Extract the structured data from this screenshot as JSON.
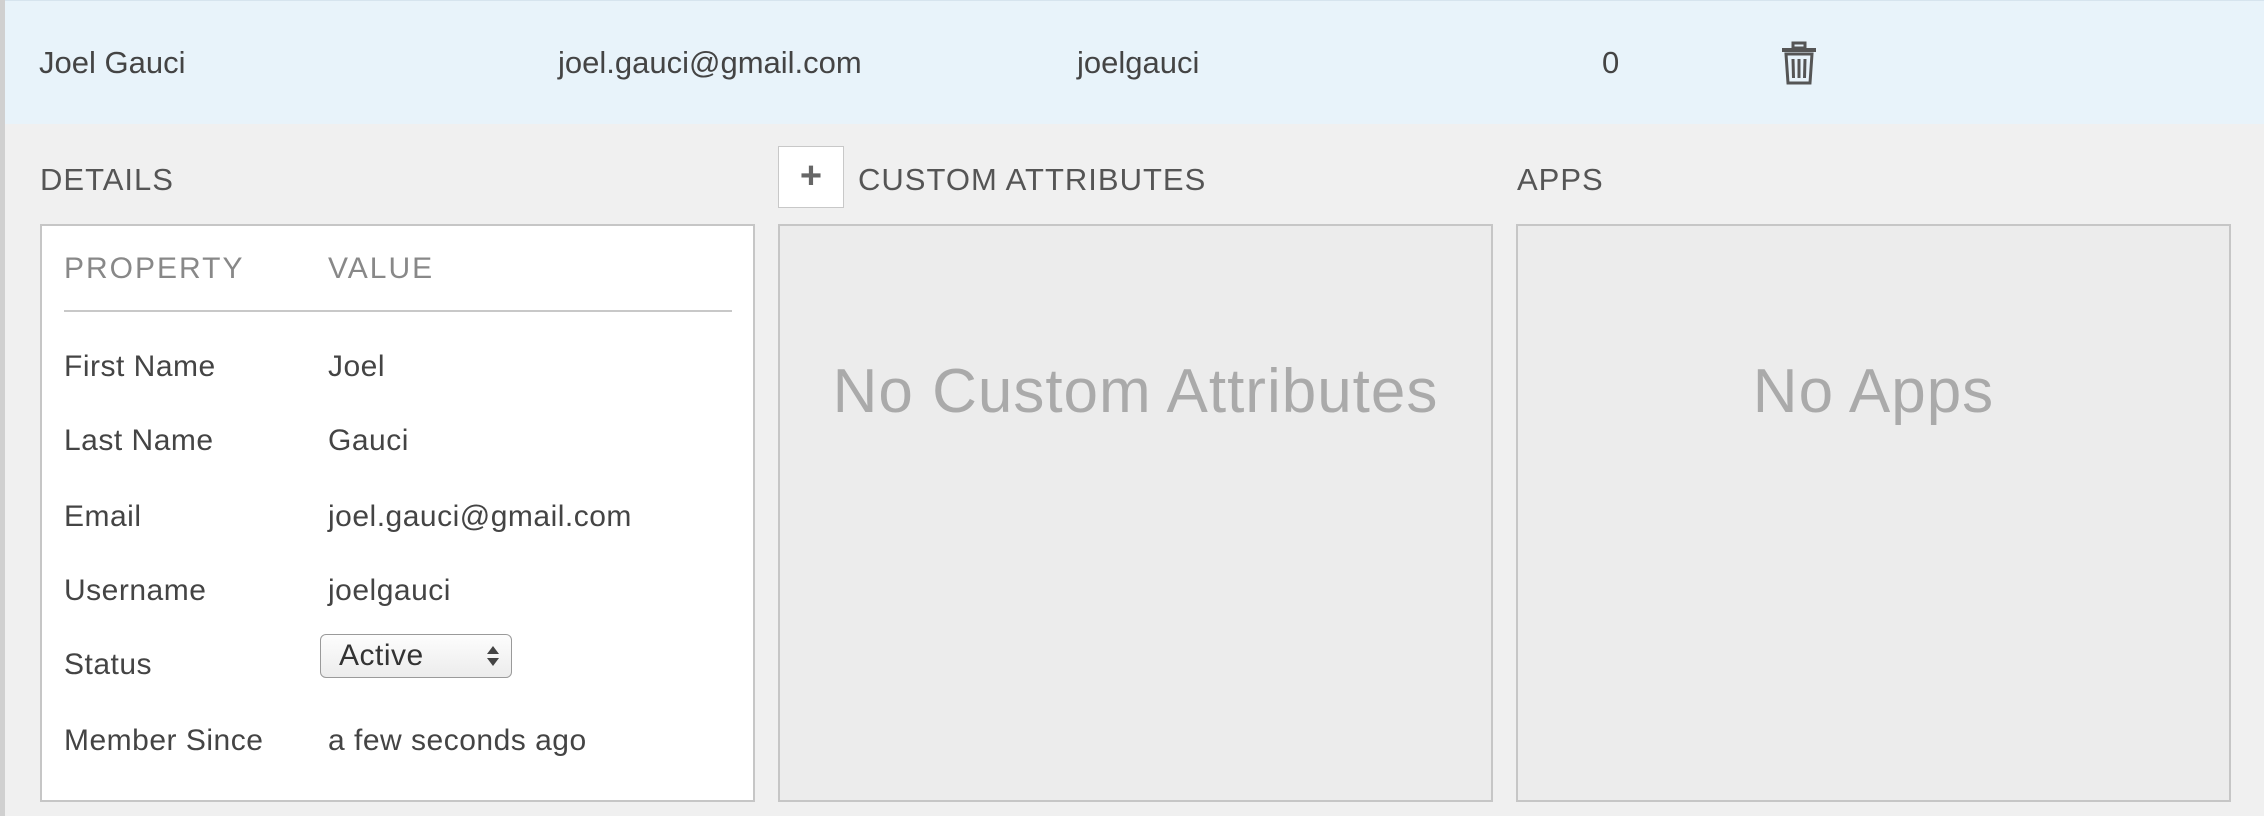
{
  "row": {
    "name": "Joel Gauci",
    "email": "joel.gauci@gmail.com",
    "username": "joelgauci",
    "count": "0",
    "delete_icon": "trash-icon"
  },
  "sections": {
    "details_title": "DETAILS",
    "custom_title": "CUSTOM ATTRIBUTES",
    "apps_title": "APPS",
    "add_button_label": "+"
  },
  "details": {
    "header_property": "PROPERTY",
    "header_value": "VALUE",
    "rows": [
      {
        "label": "First Name",
        "value": "Joel"
      },
      {
        "label": "Last Name",
        "value": "Gauci"
      },
      {
        "label": "Email",
        "value": "joel.gauci@gmail.com"
      },
      {
        "label": "Username",
        "value": "joelgauci"
      },
      {
        "label": "Status",
        "value": "Active"
      },
      {
        "label": "Member Since",
        "value": "a few seconds ago"
      }
    ]
  },
  "custom_attributes": {
    "empty_text": "No Custom Attributes"
  },
  "apps": {
    "empty_text": "No Apps"
  },
  "colors": {
    "row_highlight": "#e8f3fa",
    "panel_background": "#f0f0f0",
    "empty_text": "#aaaaaa"
  }
}
